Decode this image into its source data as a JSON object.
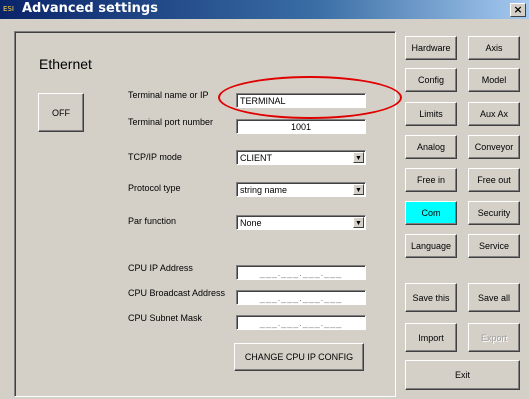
{
  "window": {
    "title": "Advanced settings",
    "app_icon": "ESI",
    "close_label": "×"
  },
  "section_title": "Ethernet",
  "off_button": "OFF",
  "fields": {
    "terminal_name_label": "Terminal name or IP",
    "terminal_name_value": "TERMINAL",
    "port_label": "Terminal port number",
    "port_value": "1001",
    "tcpip_label": "TCP/IP mode",
    "tcpip_value": "CLIENT",
    "protocol_label": "Protocol type",
    "protocol_value": "string name",
    "par_label": "Par function",
    "par_value": "None",
    "cpu_ip_label": "CPU IP Address",
    "cpu_ip_value": "___.___.___.___",
    "cpu_broadcast_label": "CPU Broadcast Address",
    "cpu_broadcast_value": "___.___.___.___",
    "cpu_subnet_label": "CPU Subnet Mask",
    "cpu_subnet_value": "___.___.___.___"
  },
  "change_cpu_ip": "CHANGE CPU IP CONFIG",
  "nav": {
    "hardware": "Hardware",
    "axis": "Axis",
    "config": "Config",
    "model": "Model",
    "limits": "Limits",
    "auxax": "Aux Ax",
    "analog": "Analog",
    "conveyor": "Conveyor",
    "freein": "Free in",
    "freeout": "Free out",
    "com": "Com",
    "security": "Security",
    "language": "Language",
    "service": "Service",
    "savethis": "Save this",
    "saveall": "Save all",
    "import": "Import",
    "export": "Export",
    "exit": "Exit"
  },
  "colors": {
    "active_tab": "#00ffff",
    "highlight": "#e00000",
    "titlebar": "#0a246a"
  }
}
